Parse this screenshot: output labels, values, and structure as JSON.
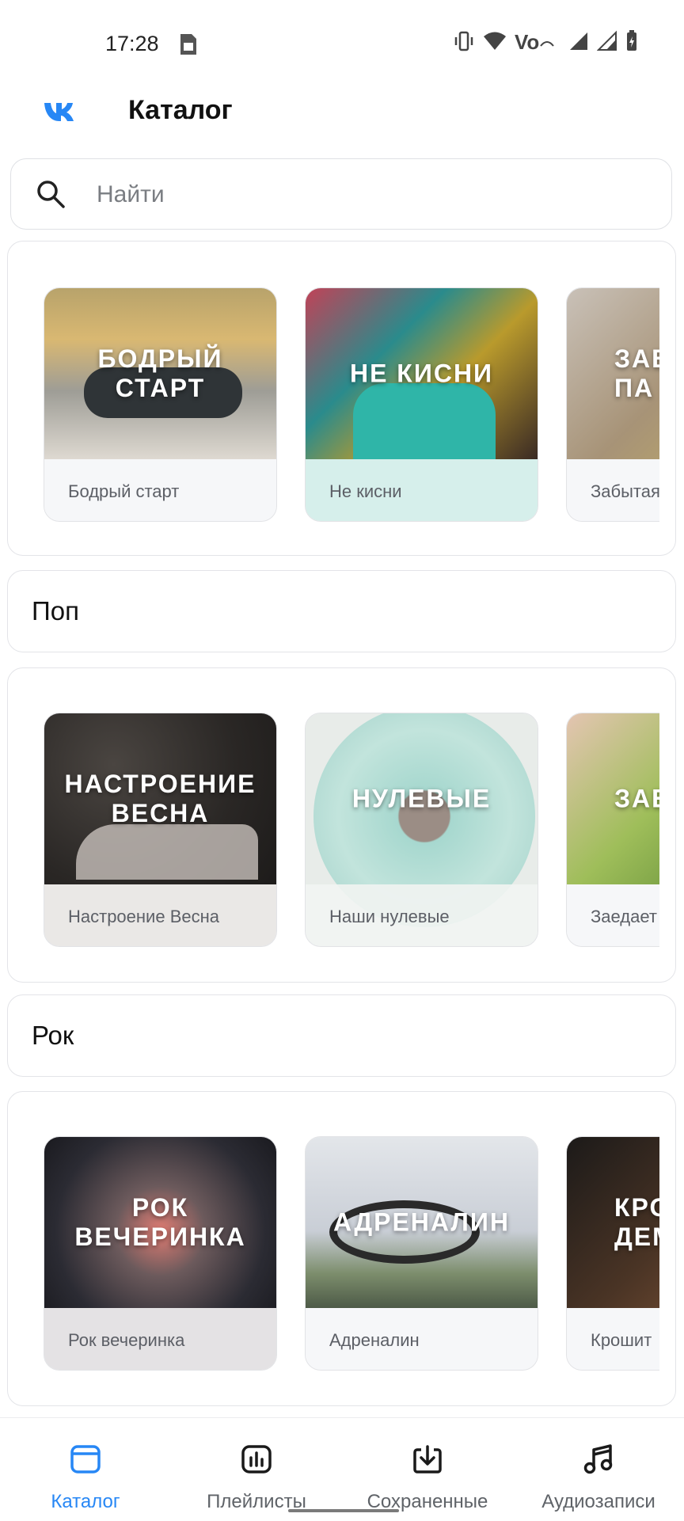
{
  "status_bar": {
    "time": "17:28"
  },
  "header": {
    "title": "Каталог"
  },
  "search": {
    "placeholder": "Найти"
  },
  "sections": [
    {
      "cards": [
        {
          "cover_text": "БОДРЫЙ\nСТАРТ",
          "name": "Бодрый старт"
        },
        {
          "cover_text": "НЕ КИСНИ",
          "name": "Не кисни"
        },
        {
          "cover_text": "ЗАБ\nПА",
          "name": "Забытая"
        }
      ]
    },
    {
      "genre": "Поп",
      "cards": [
        {
          "cover_text": "НАСТРОЕНИЕ\nВЕСНА",
          "name": "Настроение Весна"
        },
        {
          "cover_text": "НУЛЕВЫЕ",
          "name": "Наши нулевые"
        },
        {
          "cover_text": "ЗАЕ",
          "name": "Заедает"
        }
      ]
    },
    {
      "genre": "Рок",
      "cards": [
        {
          "cover_text": "РОК\nВЕЧЕРИНКА",
          "name": "Рок вечеринка"
        },
        {
          "cover_text": "АДРЕНАЛИН",
          "name": "Адреналин"
        },
        {
          "cover_text": "КРО\nДЕМ",
          "name": "Крошит"
        }
      ]
    }
  ],
  "bottom_nav": {
    "active": "catalog",
    "items": [
      {
        "id": "catalog",
        "label": "Каталог",
        "icon": "catalog-icon"
      },
      {
        "id": "playlists",
        "label": "Плейлисты",
        "icon": "playlists-icon"
      },
      {
        "id": "saved",
        "label": "Сохраненные",
        "icon": "download-icon"
      },
      {
        "id": "audio",
        "label": "Аудиозаписи",
        "icon": "music-note-icon"
      }
    ]
  },
  "colors": {
    "accent": "#2787f5",
    "text_secondary": "#5f6368",
    "border": "#e3e4e8"
  }
}
